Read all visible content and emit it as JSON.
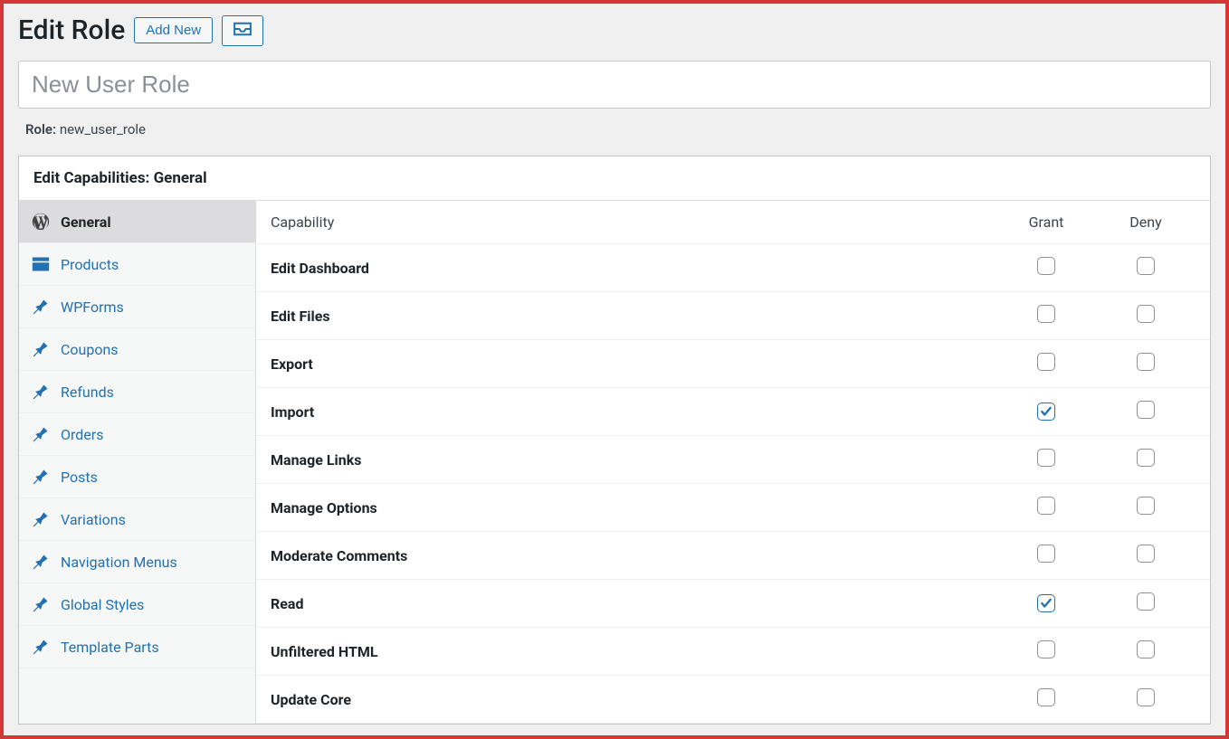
{
  "header": {
    "title": "Edit Role",
    "add_new_label": "Add New"
  },
  "role_name_input": "New User Role",
  "role_slug_label": "Role:",
  "role_slug_value": "new_user_role",
  "panel": {
    "title": "Edit Capabilities: General"
  },
  "sidebar": {
    "items": [
      {
        "label": "General",
        "icon": "wordpress",
        "active": true
      },
      {
        "label": "Products",
        "icon": "archive",
        "active": false
      },
      {
        "label": "WPForms",
        "icon": "pin",
        "active": false
      },
      {
        "label": "Coupons",
        "icon": "pin",
        "active": false
      },
      {
        "label": "Refunds",
        "icon": "pin",
        "active": false
      },
      {
        "label": "Orders",
        "icon": "pin",
        "active": false
      },
      {
        "label": "Posts",
        "icon": "pin",
        "active": false
      },
      {
        "label": "Variations",
        "icon": "pin",
        "active": false
      },
      {
        "label": "Navigation Menus",
        "icon": "pin",
        "active": false
      },
      {
        "label": "Global Styles",
        "icon": "pin",
        "active": false
      },
      {
        "label": "Template Parts",
        "icon": "pin",
        "active": false
      }
    ]
  },
  "cap_table": {
    "cols": {
      "capability": "Capability",
      "grant": "Grant",
      "deny": "Deny"
    },
    "rows": [
      {
        "name": "Edit Dashboard",
        "grant": false,
        "deny": false
      },
      {
        "name": "Edit Files",
        "grant": false,
        "deny": false
      },
      {
        "name": "Export",
        "grant": false,
        "deny": false
      },
      {
        "name": "Import",
        "grant": true,
        "deny": false
      },
      {
        "name": "Manage Links",
        "grant": false,
        "deny": false
      },
      {
        "name": "Manage Options",
        "grant": false,
        "deny": false
      },
      {
        "name": "Moderate Comments",
        "grant": false,
        "deny": false
      },
      {
        "name": "Read",
        "grant": true,
        "deny": false
      },
      {
        "name": "Unfiltered HTML",
        "grant": false,
        "deny": false
      },
      {
        "name": "Update Core",
        "grant": false,
        "deny": false
      }
    ]
  }
}
